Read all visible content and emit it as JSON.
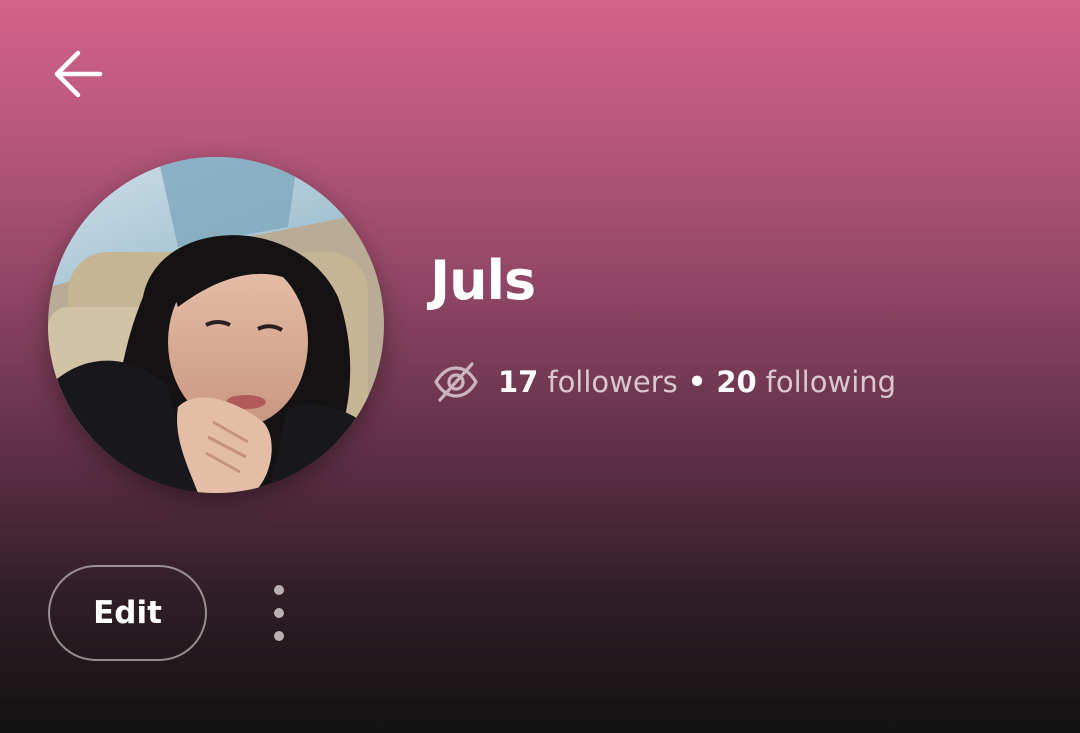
{
  "header": {
    "back_icon": "arrow-left-icon"
  },
  "profile": {
    "name": "Juls",
    "avatar_icon": "profile-photo",
    "private_icon": "eye-slash-icon",
    "followers_count": "17",
    "followers_label": "followers",
    "separator": "•",
    "following_count": "20",
    "following_label": "following"
  },
  "actions": {
    "edit_label": "Edit",
    "more_icon": "more-vertical-icon"
  },
  "colors": {
    "gradient_top": "#d46289",
    "gradient_bottom": "#121212",
    "text_primary": "#ffffff",
    "text_secondary": "#d8c4cb"
  }
}
